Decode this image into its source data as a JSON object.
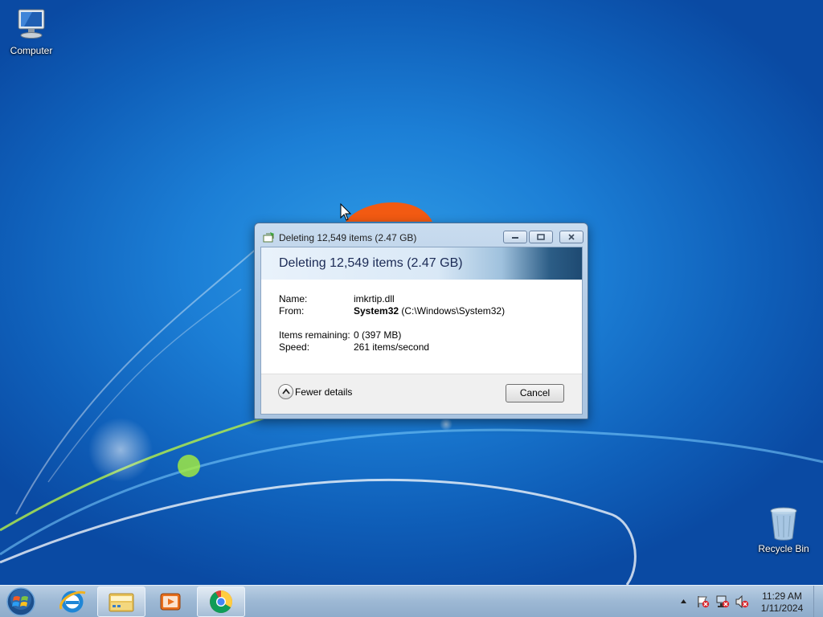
{
  "desktop": {
    "icons": [
      {
        "label": "Computer"
      },
      {
        "label": "Recycle Bin"
      }
    ]
  },
  "dialog": {
    "title": "Deleting 12,549 items (2.47 GB)",
    "heading": "Deleting 12,549 items (2.47 GB)",
    "name_label": "Name:",
    "name_value": "imkrtip.dll",
    "from_label": "From:",
    "from_bold": "System32",
    "from_path": "(C:\\Windows\\System32)",
    "remaining_label": "Items remaining:",
    "remaining_value": "0 (397 MB)",
    "speed_label": "Speed:",
    "speed_value": "261 items/second",
    "progress_state": "indeterminate",
    "fewer_details_label": "Fewer details",
    "cancel_label": "Cancel"
  },
  "taskbar": {
    "pinned": [
      "start-orb",
      "internet-explorer-icon",
      "file-explorer-icon",
      "media-player-icon",
      "chrome-icon"
    ],
    "active": [
      "file-explorer-icon",
      "chrome-icon"
    ],
    "tray": {
      "time": "11:29 AM",
      "date": "1/11/2024"
    }
  },
  "colors": {
    "accent": "#1c7fd6",
    "progress": "#25c42a"
  }
}
